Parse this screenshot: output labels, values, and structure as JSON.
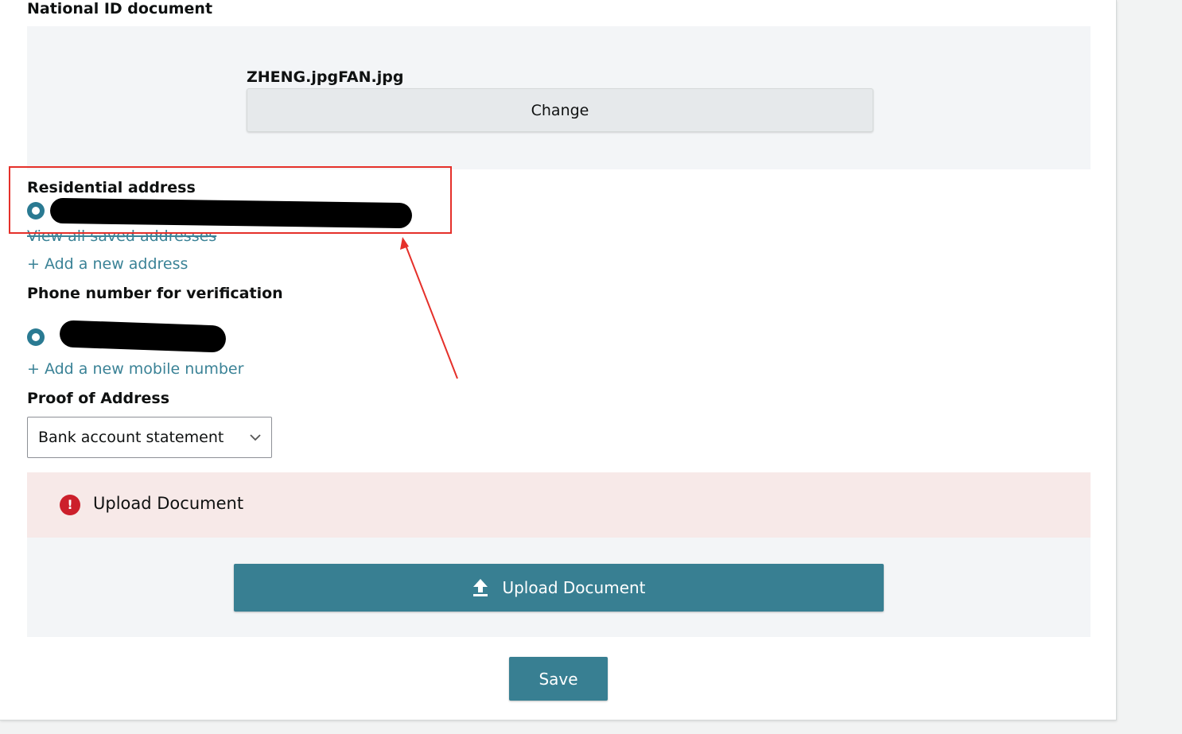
{
  "national_id": {
    "heading": "National ID document",
    "filename": "ZHENG.jpgFAN.jpg",
    "change_label": "Change"
  },
  "residential": {
    "heading": "Residential address",
    "view_all_link": "View all saved addresses",
    "add_link": "+ Add a new address"
  },
  "phone": {
    "heading": "Phone number for verification",
    "add_link": "+ Add a new mobile number"
  },
  "proof": {
    "heading": "Proof of Address",
    "selected": "Bank account statement"
  },
  "alert": {
    "text": "Upload Document",
    "icon": "error-icon"
  },
  "upload": {
    "label": "Upload Document",
    "icon": "upload-icon"
  },
  "save_label": "Save",
  "colors": {
    "accent": "#387f92",
    "link": "#3a8296",
    "error": "#cc1f2b",
    "annotation": "#e5302a"
  }
}
